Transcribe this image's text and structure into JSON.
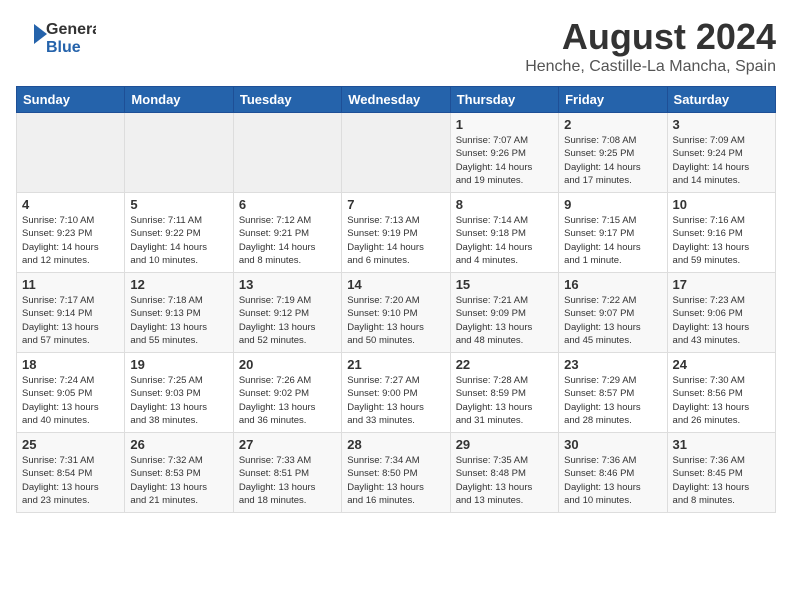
{
  "header": {
    "logo_general": "General",
    "logo_blue": "Blue",
    "main_title": "August 2024",
    "sub_title": "Henche, Castille-La Mancha, Spain"
  },
  "days_of_week": [
    "Sunday",
    "Monday",
    "Tuesday",
    "Wednesday",
    "Thursday",
    "Friday",
    "Saturday"
  ],
  "weeks": [
    [
      {
        "day": "",
        "info": ""
      },
      {
        "day": "",
        "info": ""
      },
      {
        "day": "",
        "info": ""
      },
      {
        "day": "",
        "info": ""
      },
      {
        "day": "1",
        "info": "Sunrise: 7:07 AM\nSunset: 9:26 PM\nDaylight: 14 hours\nand 19 minutes."
      },
      {
        "day": "2",
        "info": "Sunrise: 7:08 AM\nSunset: 9:25 PM\nDaylight: 14 hours\nand 17 minutes."
      },
      {
        "day": "3",
        "info": "Sunrise: 7:09 AM\nSunset: 9:24 PM\nDaylight: 14 hours\nand 14 minutes."
      }
    ],
    [
      {
        "day": "4",
        "info": "Sunrise: 7:10 AM\nSunset: 9:23 PM\nDaylight: 14 hours\nand 12 minutes."
      },
      {
        "day": "5",
        "info": "Sunrise: 7:11 AM\nSunset: 9:22 PM\nDaylight: 14 hours\nand 10 minutes."
      },
      {
        "day": "6",
        "info": "Sunrise: 7:12 AM\nSunset: 9:21 PM\nDaylight: 14 hours\nand 8 minutes."
      },
      {
        "day": "7",
        "info": "Sunrise: 7:13 AM\nSunset: 9:19 PM\nDaylight: 14 hours\nand 6 minutes."
      },
      {
        "day": "8",
        "info": "Sunrise: 7:14 AM\nSunset: 9:18 PM\nDaylight: 14 hours\nand 4 minutes."
      },
      {
        "day": "9",
        "info": "Sunrise: 7:15 AM\nSunset: 9:17 PM\nDaylight: 14 hours\nand 1 minute."
      },
      {
        "day": "10",
        "info": "Sunrise: 7:16 AM\nSunset: 9:16 PM\nDaylight: 13 hours\nand 59 minutes."
      }
    ],
    [
      {
        "day": "11",
        "info": "Sunrise: 7:17 AM\nSunset: 9:14 PM\nDaylight: 13 hours\nand 57 minutes."
      },
      {
        "day": "12",
        "info": "Sunrise: 7:18 AM\nSunset: 9:13 PM\nDaylight: 13 hours\nand 55 minutes."
      },
      {
        "day": "13",
        "info": "Sunrise: 7:19 AM\nSunset: 9:12 PM\nDaylight: 13 hours\nand 52 minutes."
      },
      {
        "day": "14",
        "info": "Sunrise: 7:20 AM\nSunset: 9:10 PM\nDaylight: 13 hours\nand 50 minutes."
      },
      {
        "day": "15",
        "info": "Sunrise: 7:21 AM\nSunset: 9:09 PM\nDaylight: 13 hours\nand 48 minutes."
      },
      {
        "day": "16",
        "info": "Sunrise: 7:22 AM\nSunset: 9:07 PM\nDaylight: 13 hours\nand 45 minutes."
      },
      {
        "day": "17",
        "info": "Sunrise: 7:23 AM\nSunset: 9:06 PM\nDaylight: 13 hours\nand 43 minutes."
      }
    ],
    [
      {
        "day": "18",
        "info": "Sunrise: 7:24 AM\nSunset: 9:05 PM\nDaylight: 13 hours\nand 40 minutes."
      },
      {
        "day": "19",
        "info": "Sunrise: 7:25 AM\nSunset: 9:03 PM\nDaylight: 13 hours\nand 38 minutes."
      },
      {
        "day": "20",
        "info": "Sunrise: 7:26 AM\nSunset: 9:02 PM\nDaylight: 13 hours\nand 36 minutes."
      },
      {
        "day": "21",
        "info": "Sunrise: 7:27 AM\nSunset: 9:00 PM\nDaylight: 13 hours\nand 33 minutes."
      },
      {
        "day": "22",
        "info": "Sunrise: 7:28 AM\nSunset: 8:59 PM\nDaylight: 13 hours\nand 31 minutes."
      },
      {
        "day": "23",
        "info": "Sunrise: 7:29 AM\nSunset: 8:57 PM\nDaylight: 13 hours\nand 28 minutes."
      },
      {
        "day": "24",
        "info": "Sunrise: 7:30 AM\nSunset: 8:56 PM\nDaylight: 13 hours\nand 26 minutes."
      }
    ],
    [
      {
        "day": "25",
        "info": "Sunrise: 7:31 AM\nSunset: 8:54 PM\nDaylight: 13 hours\nand 23 minutes."
      },
      {
        "day": "26",
        "info": "Sunrise: 7:32 AM\nSunset: 8:53 PM\nDaylight: 13 hours\nand 21 minutes."
      },
      {
        "day": "27",
        "info": "Sunrise: 7:33 AM\nSunset: 8:51 PM\nDaylight: 13 hours\nand 18 minutes."
      },
      {
        "day": "28",
        "info": "Sunrise: 7:34 AM\nSunset: 8:50 PM\nDaylight: 13 hours\nand 16 minutes."
      },
      {
        "day": "29",
        "info": "Sunrise: 7:35 AM\nSunset: 8:48 PM\nDaylight: 13 hours\nand 13 minutes."
      },
      {
        "day": "30",
        "info": "Sunrise: 7:36 AM\nSunset: 8:46 PM\nDaylight: 13 hours\nand 10 minutes."
      },
      {
        "day": "31",
        "info": "Sunrise: 7:36 AM\nSunset: 8:45 PM\nDaylight: 13 hours\nand 8 minutes."
      }
    ]
  ]
}
